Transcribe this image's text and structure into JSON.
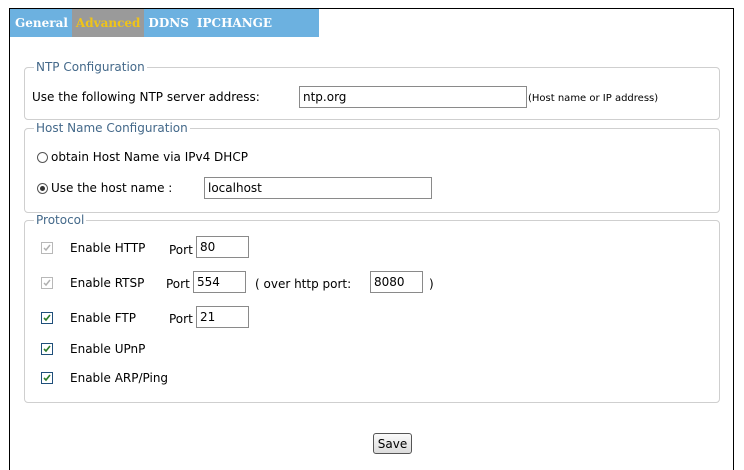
{
  "tabs": [
    {
      "label": "General",
      "active": false
    },
    {
      "label": "Advanced",
      "active": true
    },
    {
      "label": "DDNS",
      "active": false
    },
    {
      "label": "IPCHANGE",
      "active": false
    }
  ],
  "ntp": {
    "legend": "NTP Configuration",
    "label": "Use the following NTP server address:",
    "server_value": "ntp.org",
    "hint": "(Host name or IP address)"
  },
  "hostname": {
    "legend": "Host Name Configuration",
    "option_dhcp_label": "obtain Host Name via IPv4 DHCP",
    "option_dhcp_selected": false,
    "option_manual_label": "Use the host name :",
    "option_manual_selected": true,
    "host_value": "localhost"
  },
  "protocol": {
    "legend": "Protocol",
    "port_label": "Port",
    "http": {
      "label": "Enable HTTP",
      "checked": true,
      "disabled": true,
      "port": "80"
    },
    "rtsp": {
      "label": "Enable RTSP",
      "checked": true,
      "disabled": true,
      "port": "554",
      "over_http_label": "( over http port:",
      "over_http_port": "8080",
      "close_paren": ")"
    },
    "ftp": {
      "label": "Enable FTP",
      "checked": true,
      "disabled": false,
      "port": "21"
    },
    "upnp": {
      "label": "Enable UPnP",
      "checked": true,
      "disabled": false
    },
    "arp": {
      "label": "Enable ARP/Ping",
      "checked": true,
      "disabled": false
    }
  },
  "save_label": "Save",
  "colors": {
    "tab_bar": "#6cb1e0",
    "tab_active_bg": "#9a9a9a",
    "tab_active_text": "#f0c418",
    "legend_text": "#44698a",
    "checkbox_check": "#2a7a2a"
  }
}
